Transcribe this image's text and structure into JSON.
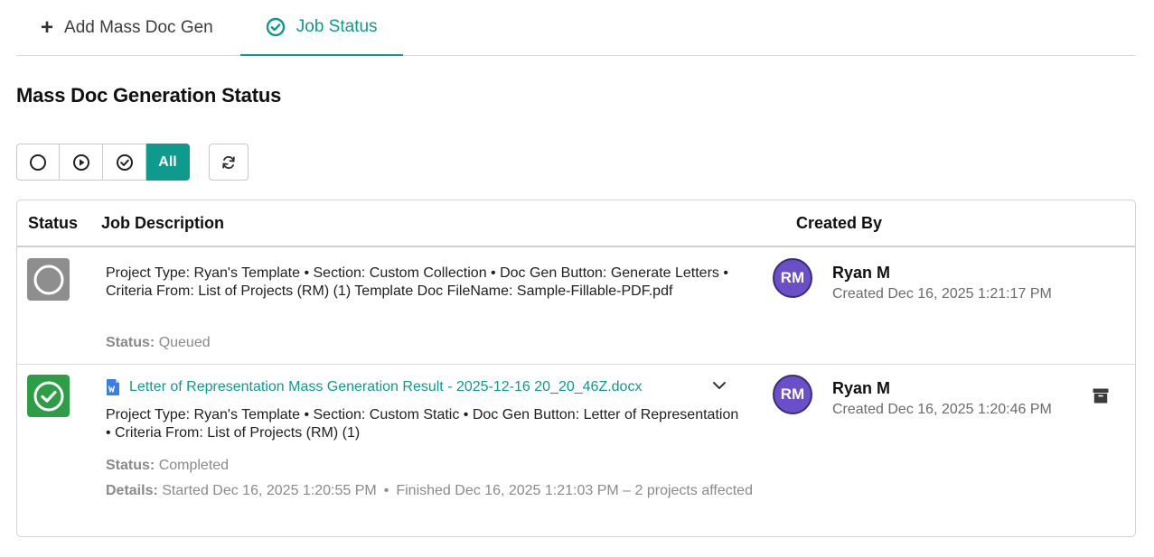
{
  "tabs": {
    "add_label": "Add Mass Doc Gen",
    "status_label": "Job Status"
  },
  "page": {
    "title": "Mass Doc Generation Status"
  },
  "filters": {
    "all_label": "All"
  },
  "table": {
    "headers": {
      "status": "Status",
      "description": "Job Description",
      "created_by": "Created By"
    },
    "rows": [
      {
        "status": "queued",
        "description": "Project Type: Ryan's Template • Section: Custom Collection • Doc Gen Button: Generate Letters • Criteria From: List of Projects (RM) (1) Template Doc FileName: Sample-Fillable-PDF.pdf",
        "status_label": "Status:",
        "status_value": "Queued",
        "avatar_initials": "RM",
        "creator_name": "Ryan M",
        "created_at": "Created Dec 16, 2025 1:21:17 PM"
      },
      {
        "status": "completed",
        "file_name": "Letter of Representation Mass Generation Result - 2025-12-16 20_20_46Z.docx",
        "description": "Project Type: Ryan's Template • Section: Custom Static • Doc Gen Button: Letter of Representation • Criteria From: List of Projects (RM) (1)",
        "status_label": "Status:",
        "status_value": "Completed",
        "details_label": "Details:",
        "details_started": "Started Dec 16, 2025 1:20:55 PM",
        "details_finished": "Finished Dec 16, 2025 1:21:03 PM – 2 projects affected",
        "avatar_initials": "RM",
        "creator_name": "Ryan M",
        "created_at": "Created Dec 16, 2025 1:20:46 PM"
      }
    ]
  },
  "colors": {
    "accent": "#0f9a8e",
    "completed": "#2e9e46",
    "queued": "#8e8e8e",
    "avatar": "#6a4fc9"
  },
  "icons": {
    "add": "plus-icon",
    "job_status": "check-circle-icon",
    "filter_queued": "circle-icon",
    "filter_running": "play-circle-icon",
    "filter_completed": "check-circle-icon",
    "refresh": "refresh-icon",
    "file": "word-doc-icon",
    "expand": "chevron-down-icon",
    "archive": "archive-icon"
  }
}
